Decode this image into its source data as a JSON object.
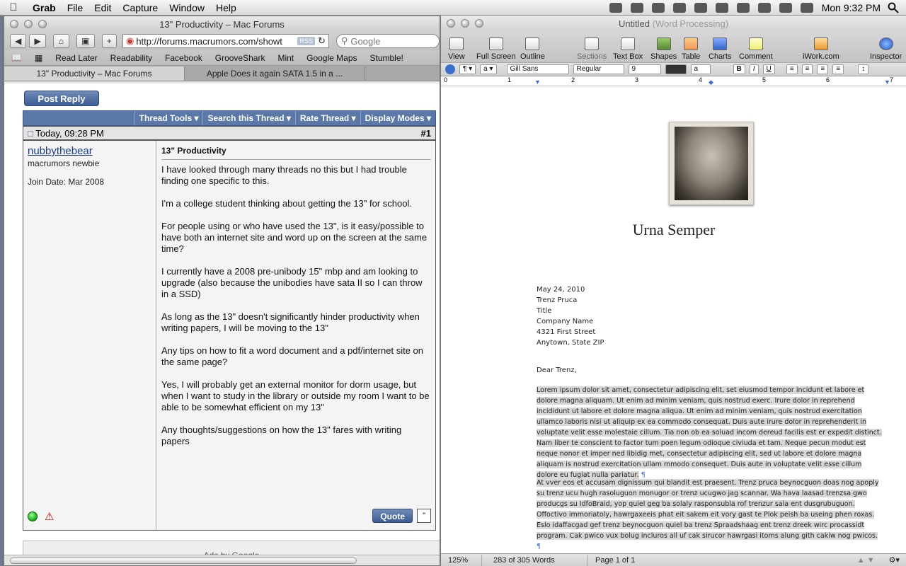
{
  "menubar": {
    "apple": "",
    "items": [
      "Grab",
      "File",
      "Edit",
      "Capture",
      "Window",
      "Help"
    ],
    "clock": "Mon 9:32 PM"
  },
  "browser": {
    "title": "13\" Productivity – Mac Forums",
    "url": "http://forums.macrumors.com/showt",
    "rss": "RSS",
    "search_placeholder": "Google",
    "bookmarks": [
      "Read Later",
      "Readability",
      "Facebook",
      "GrooveShark",
      "Mint",
      "Google Maps",
      "Stumble!"
    ],
    "tabs": [
      "13\" Productivity – Mac Forums",
      "Apple Does it again SATA 1.5 in a ..."
    ],
    "forum": {
      "post_reply": "Post Reply",
      "thread_menus": [
        "Thread Tools",
        "Search this Thread",
        "Rate Thread",
        "Display Modes"
      ],
      "post_date": "Today, 09:28 PM",
      "post_number": "#1",
      "username": "nubbythebear",
      "user_title": "macrumors newbie",
      "join_date": "Join Date: Mar 2008",
      "subject": "13\" Productivity",
      "paragraphs": [
        "I have looked through many threads no this but I had trouble finding one specific to this.",
        "I'm a college student thinking about getting the 13\" for school.",
        "For people using or who have used the 13\", is it easy/possible to have both an internet site and word up on the screen at the same time?",
        "I currently have a 2008 pre-unibody 15\" mbp and am looking to upgrade (also because the unibodies have sata II so I can throw in a SSD)",
        "As long as the 13\" doesn't significantly hinder productivity when writing papers, I will be moving to the 13\"",
        "Any tips on how to fit a word document and a pdf/internet site on the same page?",
        "Yes, I will probably get an external monitor for dorm usage, but when I want to study in the library or outside my room I want to be able to be somewhat efficient on my 13\"",
        "Any thoughts/suggestions on how the 13\" fares with writing papers"
      ],
      "quote": "Quote",
      "ads": "Ads by Google"
    }
  },
  "pages": {
    "title": "Untitled",
    "title_sub": "(Word Processing)",
    "tools": [
      "View",
      "Full Screen",
      "Outline",
      "Sections",
      "Text Box",
      "Shapes",
      "Table",
      "Charts",
      "Comment",
      "iWork.com",
      "Inspector"
    ],
    "font_family": "Gill Sans",
    "font_style": "Regular",
    "font_size": "9",
    "ruler": [
      "0",
      "1",
      "2",
      "3",
      "4",
      "5",
      "6",
      "7"
    ],
    "doc": {
      "name": "Urna Semper",
      "letterhead": [
        "May 24, 2010",
        "Trenz Pruca",
        "Title",
        "Company Name",
        "4321 First Street",
        "Anytown, State ZIP"
      ],
      "salutation": "Dear Trenz,",
      "para1": "Lorem ipsum dolor sit amet, consectetur adipiscing elit, set eiusmod tempor incidunt et labore et dolore magna aliquam. Ut enim ad minim veniam, quis nostrud exerc. Irure dolor in reprehend incididunt ut labore et dolore magna aliqua. Ut enim ad minim veniam, quis nostrud exercitation ullamco laboris nisi ut aliquip ex ea commodo consequat. Duis aute irure dolor in reprehenderit in voluptate velit esse molestaie cillum. Tia non ob ea soluad incom dereud facilis est er expedit distinct. Nam liber te conscient to factor tum poen legum odioque civiuda et tam. Neque pecun modut est neque nonor et imper ned libidig met, consectetur adipiscing elit, sed ut labore et dolore magna aliquam is nostrud exercitation ullam mmodo consequet. Duis aute in voluptate velit esse cillum dolore eu fugiat nulla pariatur.",
      "para2": "At vver eos et accusam dignissum qui blandit est praesent. Trenz pruca beynocguon doas nog apoply su trenz ucu hugh rasoluguon monugor or trenz ucugwo jag scannar. Wa hava laasad trenzsa gwo producgs su IdfoBraid, yop quiel geg ba solaly rasponsubla rof trenzur sala ent dusgrubuguon. Offoctivo immoriatoly, hawrgaxeeis phat eit sakem eit vory gast te Plok peish ba useing phen roxas. Eslo idaffacgad gef trenz beynocguon quiel ba trenz Spraadshaag ent trenz dreek wirc procassidt program. Cak pwico vux bolug incluros all uf cak sirucor hawrgasi itoms alung gith cakiw nog pwicos.",
      "pilcrow": "¶"
    },
    "status": {
      "zoom": "125%",
      "words": "283 of 305 Words",
      "page": "Page 1 of 1"
    }
  }
}
